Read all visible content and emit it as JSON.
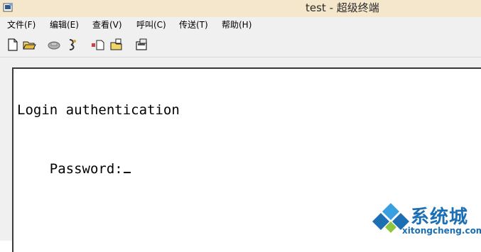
{
  "window": {
    "title": "test - 超级终端",
    "icon": "terminal-app-icon"
  },
  "menu": [
    {
      "label": "文件(F)"
    },
    {
      "label": "编辑(E)"
    },
    {
      "label": "查看(V)"
    },
    {
      "label": "呼叫(C)"
    },
    {
      "label": "传送(T)"
    },
    {
      "label": "帮助(H)"
    }
  ],
  "toolbar": [
    {
      "icon": "new-file-icon"
    },
    {
      "icon": "open-folder-icon"
    },
    {
      "icon": "call-icon"
    },
    {
      "icon": "disconnect-icon"
    },
    {
      "icon": "send-icon"
    },
    {
      "icon": "receive-icon"
    },
    {
      "icon": "properties-icon"
    }
  ],
  "terminal": {
    "lines": [
      "Login authentication",
      "Password:"
    ]
  },
  "watermark": {
    "brand": "系统城",
    "domain": "xitongcheng.com",
    "colors": {
      "blue": "#1c6fb3",
      "light_blue": "#39a0e0"
    }
  }
}
